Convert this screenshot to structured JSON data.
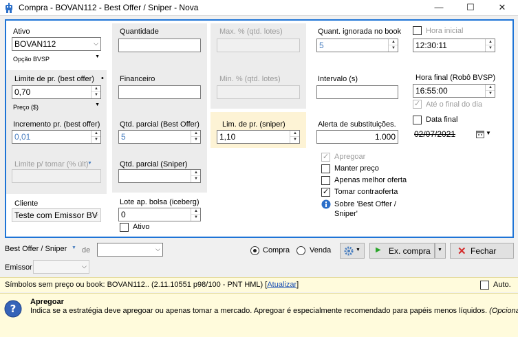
{
  "window": {
    "title": "Compra - BOVAN112 - Best Offer / Sniper - Nova",
    "minimize": "—",
    "maximize": "☐",
    "close": "✕"
  },
  "form": {
    "ativo_label": "Ativo",
    "ativo_value": "BOVAN112",
    "opcao_value": "Opção BVSP",
    "limite_pr_label": "Limite de pr. (best offer)",
    "limite_pr_marker": "•",
    "limite_pr_value": "0,70",
    "preco_value": "Preço ($)",
    "incremento_label": "Incremento pr. (best offer)",
    "incremento_value": "0,01",
    "limite_tomar_label": "Limite p/ tomar (% últ)",
    "limite_tomar_value": "",
    "cliente_label": "Cliente",
    "cliente_value": "Teste com Emissor BV",
    "quantidade_label": "Quantidade",
    "quantidade_value": "",
    "financeiro_label": "Financeiro",
    "financeiro_value": "",
    "qtd_parcial_best_label": "Qtd. parcial (Best Offer)",
    "qtd_parcial_best_value": "5",
    "qtd_parcial_sniper_label": "Qtd. parcial (Sniper)",
    "qtd_parcial_sniper_value": "",
    "lote_iceberg_label": "Lote ap. bolsa (iceberg)",
    "lote_iceberg_value": "0",
    "ativo_chk_label": "Ativo",
    "max_pct_label": "Max. % (qtd. lotes)",
    "max_pct_value": "",
    "min_pct_label": "Min. % (qtd. lotes)",
    "min_pct_value": "",
    "lim_sniper_label": "Lim. de pr. (sniper)",
    "lim_sniper_value": "1,10",
    "quant_ignorada_label": "Quant. ignorada no book",
    "quant_ignorada_value": "5",
    "intervalo_label": "Intervalo (s)",
    "intervalo_value": "",
    "alerta_label": "Alerta de substituições.",
    "alerta_value": "1.000",
    "apregoar_label": "Apregoar",
    "manter_preco_label": "Manter preço",
    "apenas_melhor_label": "Apenas melhor oferta",
    "tomar_contraoferta_label": "Tomar contraoferta",
    "sobre_label": "Sobre 'Best Offer / Sniper'",
    "hora_inicial_label": "Hora inicial",
    "hora_inicial_value": "12:30:11",
    "hora_final_label": "Hora final (Robô BVSP)",
    "hora_final_value": "16:55:00",
    "ate_final_label": "Até o final do dia",
    "data_final_label": "Data final",
    "data_final_value": "02/07/2021"
  },
  "bottom": {
    "strategy_value": "Best Offer / Sniper",
    "de_label": "de",
    "de_value": "",
    "compra_label": "Compra",
    "venda_label": "Venda",
    "ex_compra_label": "Ex. compra",
    "fechar_label": "Fechar",
    "emissor_label": "Emissor",
    "emissor_value": ""
  },
  "info": {
    "text": "Símbolos sem preço ou book: BOVAN112..  (2.11.10551 p98/100 - PNT HML) [",
    "link": "Atualizar",
    "close_bracket": "]",
    "auto_label": "Auto."
  },
  "help": {
    "title": "Apregoar",
    "body": "Indica se a estratégia deve apregoar ou apenas tomar a mercado. Apregoar é especialmente recomendado para papéis menos líquidos.",
    "optional": "(Opcional)"
  },
  "colors": {
    "accent": "#1e74d6",
    "info_bg": "#fffbdc",
    "sniper_bg": "#fdf3d5"
  }
}
